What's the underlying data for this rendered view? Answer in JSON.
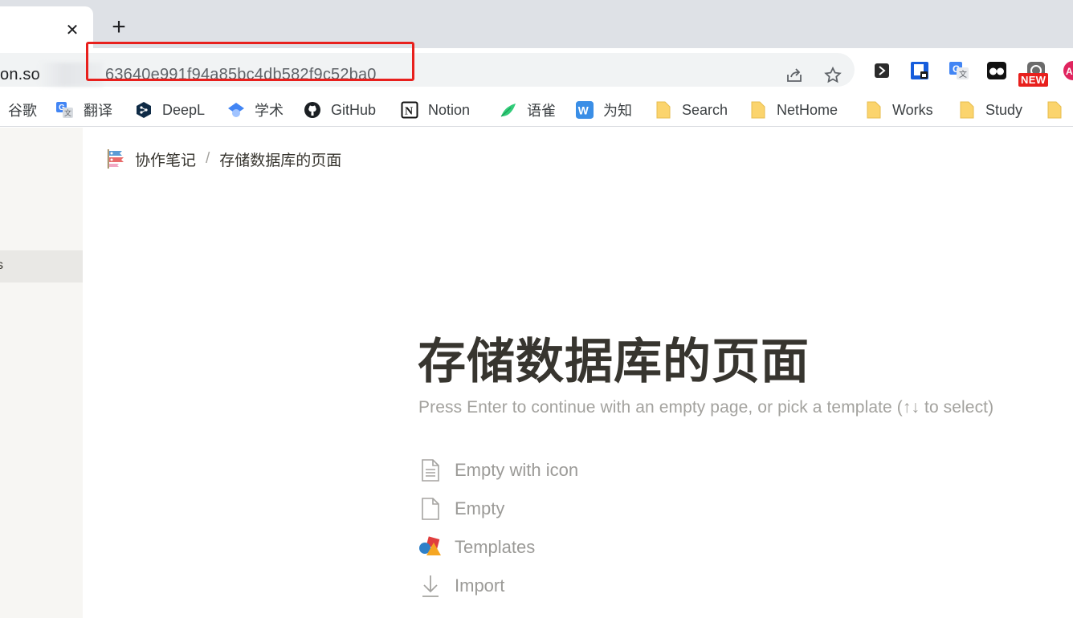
{
  "browser": {
    "tab": {
      "close_glyph": "✕"
    },
    "new_tab_glyph": "+",
    "omnibox": {
      "host_visible": "on.so",
      "path": "63640e991f94a85bc4db582f9c52ba0"
    },
    "extensions": [
      {
        "name": "extension-dark-icon"
      },
      {
        "name": "extension-bitwarden-icon"
      },
      {
        "name": "extension-translate-icon"
      },
      {
        "name": "extension-eyes-icon"
      },
      {
        "name": "extension-camera-icon"
      },
      {
        "name": "extension-adblock-icon"
      }
    ],
    "new_badge": "NEW"
  },
  "bookmarks": [
    {
      "label": "谷歌",
      "icon": "google-icon"
    },
    {
      "label": "翻译",
      "icon": "translate-icon"
    },
    {
      "label": "DeepL",
      "icon": "deepl-icon"
    },
    {
      "label": "学术",
      "icon": "scholar-icon"
    },
    {
      "label": "GitHub",
      "icon": "github-icon"
    },
    {
      "label": "Notion",
      "icon": "notion-icon"
    },
    {
      "label": "语雀",
      "icon": "yuque-icon"
    },
    {
      "label": "为知",
      "icon": "wiz-icon"
    },
    {
      "label": "Search",
      "icon": "folder-icon"
    },
    {
      "label": "NetHome",
      "icon": "folder-icon"
    },
    {
      "label": "Works",
      "icon": "folder-icon"
    },
    {
      "label": "Study",
      "icon": "folder-icon"
    }
  ],
  "sidebar": {
    "active_label": "s"
  },
  "breadcrumb": {
    "parent": "协作笔记",
    "separator": "/",
    "current": "存储数据库的页面"
  },
  "page": {
    "title": "存储数据库的页面",
    "hint": "Press Enter to continue with an empty page, or pick a template (↑↓ to select)",
    "options": [
      {
        "label": "Empty with icon",
        "icon": "document-lines-icon"
      },
      {
        "label": "Empty",
        "icon": "document-icon"
      },
      {
        "label": "Templates",
        "icon": "shapes-icon"
      },
      {
        "label": "Import",
        "icon": "download-arrow-icon"
      }
    ]
  },
  "colors": {
    "highlight": "#e8201d",
    "folder": "#fbd46d",
    "text": "#37352f",
    "muted": "#9b9a97"
  }
}
